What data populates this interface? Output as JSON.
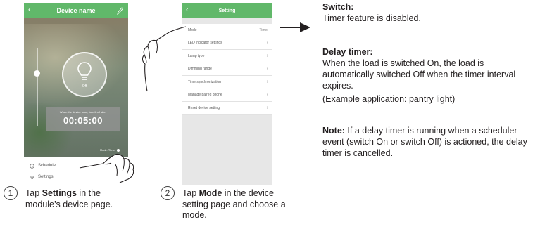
{
  "phone1": {
    "title": "Device name",
    "bulb_state": "Off",
    "timer_note": "When the device is on, turn it off after",
    "timer_value": "00:05:00",
    "mode_status": "Mode: Timer",
    "menu": [
      {
        "label": "Schedule",
        "icon": "clock-icon"
      },
      {
        "label": "Settings",
        "icon": "gear-icon"
      }
    ]
  },
  "phone2": {
    "title": "Setting",
    "rows": [
      {
        "label": "Mode",
        "value": "Timer"
      },
      {
        "label": "LED indicator settings"
      },
      {
        "label": "Lamp type"
      },
      {
        "label": "Dimming range"
      },
      {
        "label": "Time synchronization"
      },
      {
        "label": "Manage paired phone"
      },
      {
        "label": "Reset device setting"
      }
    ]
  },
  "steps": [
    {
      "num": "1",
      "pre": "Tap ",
      "bold": "Settings",
      "post": " in the module’s device page."
    },
    {
      "num": "2",
      "pre": "Tap ",
      "bold": "Mode",
      "post": " in the device setting page and choose a mode."
    }
  ],
  "info": {
    "switch_heading": "Switch:",
    "switch_text": "Timer feature is disabled.",
    "delay_heading": "Delay timer:",
    "delay_text": "When the load is switched On, the load is automatically switched Off when the timer interval expires.",
    "delay_example": "(Example application: pantry light)",
    "note_label": "Note:",
    "note_text": " If a delay timer is running when a scheduler event (switch On or switch Off) is actioned, the delay timer is cancelled."
  },
  "colors": {
    "accent": "#61b86a",
    "text": "#231f20"
  }
}
